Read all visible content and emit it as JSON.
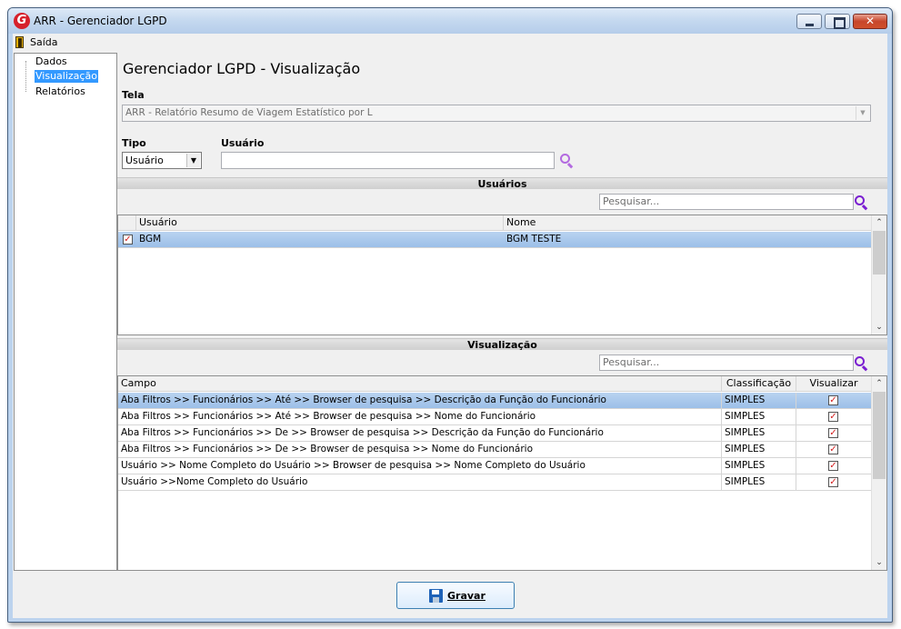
{
  "window": {
    "title": "ARR - Gerenciador LGPD",
    "app_icon_letter": "G"
  },
  "menu": {
    "exit_label": "Saída"
  },
  "nav": {
    "items": [
      "Dados",
      "Visualização",
      "Relatórios"
    ],
    "selected_index": 1
  },
  "page": {
    "title": "Gerenciador LGPD - Visualização"
  },
  "tela": {
    "label": "Tela",
    "value": "ARR - Relatório Resumo de Viagem Estatístico por L"
  },
  "tipo": {
    "label": "Tipo",
    "value": "Usuário"
  },
  "usuario_filter": {
    "label": "Usuário",
    "value": ""
  },
  "usuarios_section": {
    "title": "Usuários",
    "search_placeholder": "Pesquisar...",
    "columns": [
      "Usuário",
      "Nome"
    ],
    "rows": [
      {
        "checked": true,
        "usuario": "BGM",
        "nome": "BGM TESTE",
        "selected": true
      }
    ]
  },
  "visualizacao_section": {
    "title": "Visualização",
    "search_placeholder": "Pesquisar...",
    "columns": [
      "Campo",
      "Classificação",
      "Visualizar"
    ],
    "rows": [
      {
        "campo": "Aba Filtros >> Funcionários >> Até >> Browser de pesquisa >> Descrição da Função do Funcionário",
        "classificacao": "SIMPLES",
        "visualizar": true,
        "selected": true
      },
      {
        "campo": "Aba Filtros >> Funcionários >> Até >> Browser de pesquisa >> Nome do Funcionário",
        "classificacao": "SIMPLES",
        "visualizar": true,
        "selected": false
      },
      {
        "campo": "Aba Filtros >> Funcionários >> De >> Browser de pesquisa >> Descrição da Função do Funcionário",
        "classificacao": "SIMPLES",
        "visualizar": true,
        "selected": false
      },
      {
        "campo": "Aba Filtros >> Funcionários >> De >> Browser de pesquisa >> Nome do Funcionário",
        "classificacao": "SIMPLES",
        "visualizar": true,
        "selected": false
      },
      {
        "campo": "Usuário >> Nome Completo do Usuário >> Browser de pesquisa >> Nome Completo do Usuário",
        "classificacao": "SIMPLES",
        "visualizar": true,
        "selected": false
      },
      {
        "campo": "Usuário >>Nome Completo do Usuário",
        "classificacao": "SIMPLES",
        "visualizar": true,
        "selected": false
      }
    ]
  },
  "buttons": {
    "save_label": "Gravar"
  },
  "colors": {
    "accent_search": "#7a1fd1",
    "search_light": "#b36ae0",
    "selected_nav": "#3399ff",
    "checkbox_mark": "#d42020"
  }
}
